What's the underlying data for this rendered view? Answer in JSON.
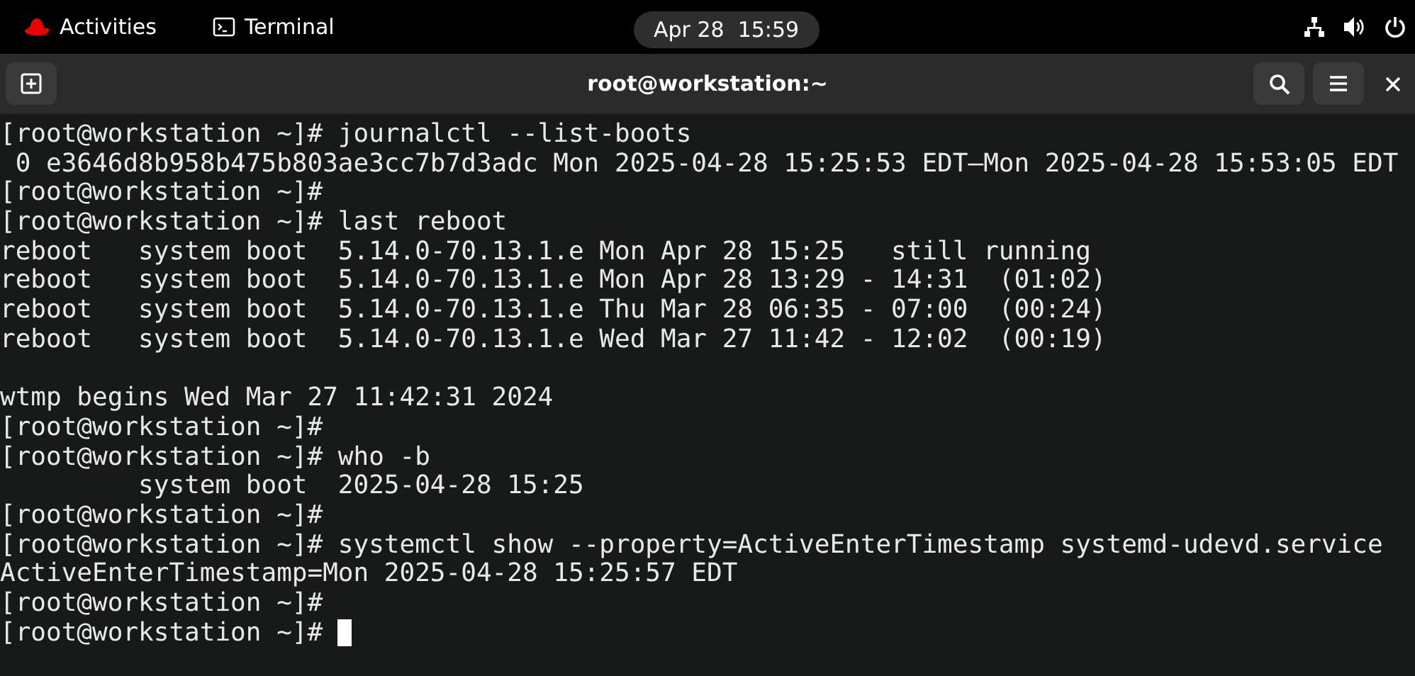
{
  "top_bar": {
    "activities": "Activities",
    "app": "Terminal",
    "clock": "Apr 28  15:59"
  },
  "window": {
    "title": "root@workstation:~"
  },
  "terminal": {
    "lines": [
      {
        "text": "[root@workstation ~]# journalctl --list-boots"
      },
      {
        "text": " 0 e3646d8b958b475b803ae3cc7b7d3adc Mon 2025-04-28 15:25:53 EDT—Mon 2025-04-28 15:53:05 EDT"
      },
      {
        "text": "[root@workstation ~]#"
      },
      {
        "text": "[root@workstation ~]# last reboot"
      },
      {
        "text": "reboot   system boot  5.14.0-70.13.1.e Mon Apr 28 15:25   still running"
      },
      {
        "text": "reboot   system boot  5.14.0-70.13.1.e Mon Apr 28 13:29 - 14:31  (01:02)"
      },
      {
        "text": "reboot   system boot  5.14.0-70.13.1.e Thu Mar 28 06:35 - 07:00  (00:24)"
      },
      {
        "text": "reboot   system boot  5.14.0-70.13.1.e Wed Mar 27 11:42 - 12:02  (00:19)"
      },
      {
        "text": "wtmp begins Wed Mar 27 11:42:31 2024",
        "blank_before": true
      },
      {
        "text": "[root@workstation ~]#"
      },
      {
        "text": "[root@workstation ~]# who -b"
      },
      {
        "text": "         system boot  2025-04-28 15:25"
      },
      {
        "text": "[root@workstation ~]#"
      },
      {
        "text": "[root@workstation ~]# systemctl show --property=ActiveEnterTimestamp systemd-udevd.service"
      },
      {
        "text": "ActiveEnterTimestamp=Mon 2025-04-28 15:25:57 EDT"
      },
      {
        "text": "[root@workstation ~]#"
      },
      {
        "text": "[root@workstation ~]# ",
        "cursor": true
      }
    ]
  }
}
